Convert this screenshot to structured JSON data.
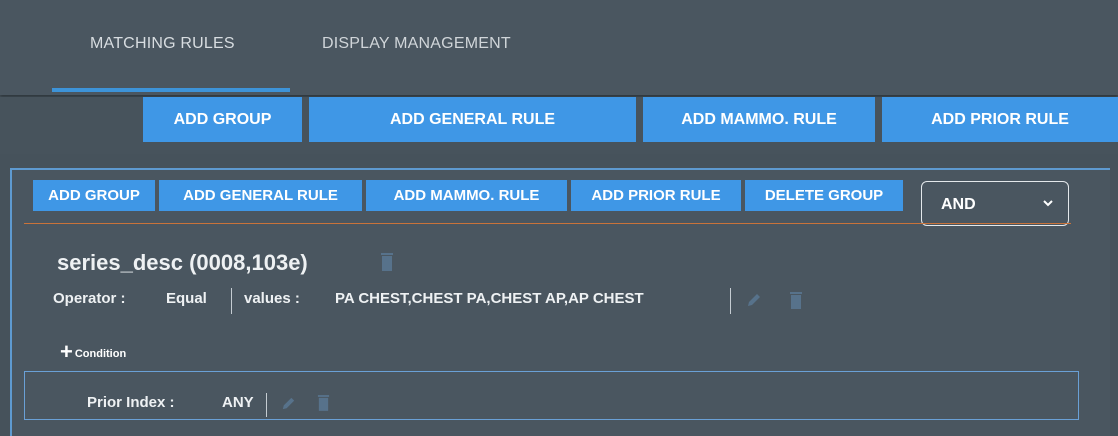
{
  "tabs": [
    {
      "label": "MATCHING RULES",
      "active": true
    },
    {
      "label": "DISPLAY MANAGEMENT",
      "active": false
    }
  ],
  "toolbar": {
    "add_group": "ADD GROUP",
    "add_general_rule": "ADD GENERAL RULE",
    "add_mammo_rule": "ADD MAMMO. RULE",
    "add_prior_rule": "ADD PRIOR RULE"
  },
  "group": {
    "buttons": {
      "add_group": "ADD GROUP",
      "add_general_rule": "ADD GENERAL RULE",
      "add_mammo_rule": "ADD MAMMO. RULE",
      "add_prior_rule": "ADD PRIOR RULE",
      "delete_group": "DELETE GROUP"
    },
    "logic_select": {
      "value": "AND"
    }
  },
  "rule": {
    "title": "series_desc (0008,103e)",
    "operator_label": "Operator :",
    "operator_value": "Equal",
    "values_label": "values :",
    "values_value": "PA CHEST,CHEST PA,CHEST AP,AP CHEST",
    "add_condition": "Condition"
  },
  "prior_rule": {
    "label": "Prior Index :",
    "value": "ANY"
  },
  "colors": {
    "background": "#46525b",
    "button_blue": "#3f97e6",
    "tab_underline": "#3d93d8",
    "divider_orange": "#c9733a",
    "box_border": "#6aa0d6"
  }
}
